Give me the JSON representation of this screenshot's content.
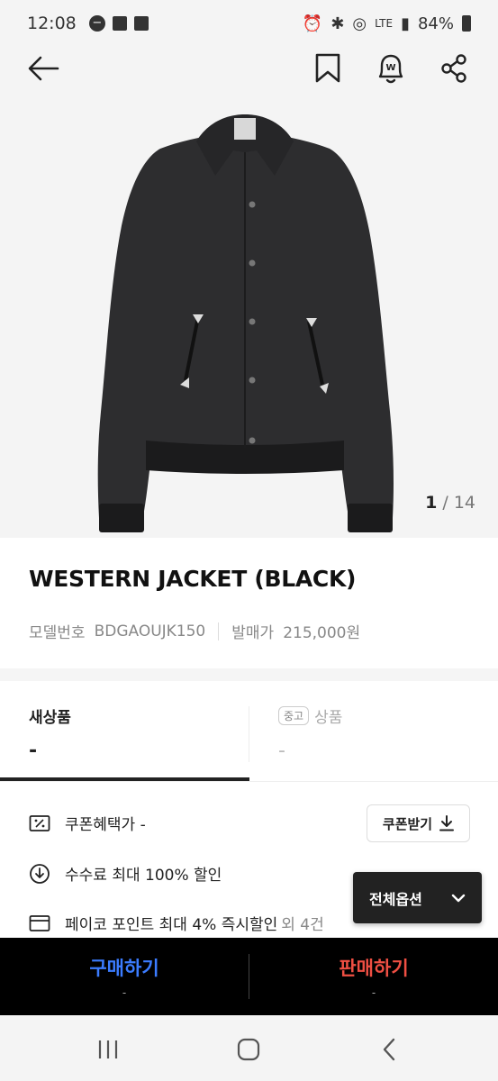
{
  "status_bar": {
    "time": "12:08",
    "network": "LTE",
    "battery": "84%"
  },
  "gallery": {
    "current": "1",
    "separator": "/",
    "total": "14"
  },
  "product": {
    "name": "WESTERN JACKET (BLACK)",
    "model_label": "모델번호",
    "model_value": "BDGAOUJK150",
    "release_price_label": "발매가",
    "release_price_value": "215,000원"
  },
  "tabs": {
    "new_label": "새상품",
    "new_value": "-",
    "used_chip": "중고",
    "used_label": "상품",
    "used_value": "-"
  },
  "benefits": {
    "coupon_price": "쿠폰혜택가 -",
    "coupon_button": "쿠폰받기",
    "fee_discount": "수수료 최대 100% 할인",
    "point_discount": "페이코 포인트 최대 4% 즉시할인",
    "point_extra": "외 4건"
  },
  "options_button": "전체옵션",
  "actions": {
    "buy_label": "구매하기",
    "buy_price": "-",
    "sell_label": "판매하기",
    "sell_price": "-"
  },
  "colors": {
    "buy": "#3b7cff",
    "sell": "#ef4f43",
    "action_bar": "#000000"
  }
}
